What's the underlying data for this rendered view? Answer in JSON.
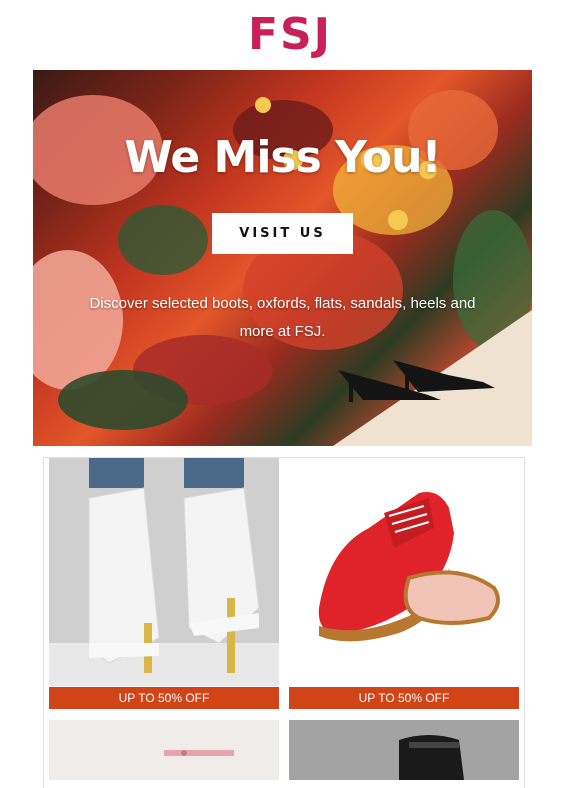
{
  "brand": {
    "logo_text": "FSJ",
    "color": "#c8215a"
  },
  "hero": {
    "title": "We Miss You!",
    "button_label": "VISIT US",
    "text": "Discover selected boots, oxfords, flats, sandals, heels and more at FSJ."
  },
  "products": [
    {
      "image": "white-lace-heel-bootie",
      "badge": "UP TO 50% OFF"
    },
    {
      "image": "red-oxford-shoe",
      "badge": "UP TO 50% OFF"
    },
    {
      "image": "pink-heel-sandal",
      "badge": ""
    },
    {
      "image": "black-sock-bootie",
      "badge": ""
    }
  ],
  "colors": {
    "badge": "#d04418",
    "button_bg": "#ffffff"
  }
}
